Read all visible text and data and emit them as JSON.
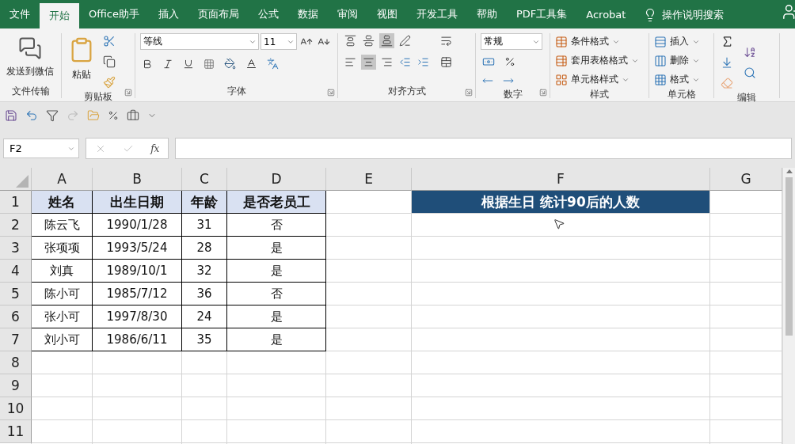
{
  "tabs": [
    {
      "label": "文件",
      "selected": false
    },
    {
      "label": "开始",
      "selected": true
    },
    {
      "label": "Office助手",
      "selected": false
    },
    {
      "label": "插入",
      "selected": false
    },
    {
      "label": "页面布局",
      "selected": false
    },
    {
      "label": "公式",
      "selected": false
    },
    {
      "label": "数据",
      "selected": false
    },
    {
      "label": "审阅",
      "selected": false
    },
    {
      "label": "视图",
      "selected": false
    },
    {
      "label": "开发工具",
      "selected": false
    },
    {
      "label": "帮助",
      "selected": false
    },
    {
      "label": "PDF工具集",
      "selected": false
    },
    {
      "label": "Acrobat",
      "selected": false
    }
  ],
  "search": {
    "label": "操作说明搜索"
  },
  "ribbon": {
    "groups": [
      {
        "kind": "share",
        "label": "文件传输",
        "buttons": [
          {
            "label": "发送到微信"
          }
        ]
      },
      {
        "kind": "clipboard",
        "label": "剪贴板",
        "buttons": [
          {
            "label": "粘贴"
          }
        ]
      },
      {
        "kind": "font",
        "label": "字体",
        "font": "等线",
        "size": "11"
      },
      {
        "kind": "alignment",
        "label": "对齐方式",
        "vertical_align": [
          {
            "selected": false
          },
          {
            "selected": false
          },
          {
            "selected": true
          }
        ],
        "horizontal_align": [
          {
            "selected": false
          },
          {
            "selected": true
          },
          {
            "selected": false
          }
        ]
      },
      {
        "kind": "number",
        "label": "数字",
        "format": "常规"
      },
      {
        "kind": "styles",
        "label": "样式",
        "buttons": [
          {
            "label": "条件格式"
          },
          {
            "label": "套用表格格式"
          },
          {
            "label": "单元格样式"
          }
        ]
      },
      {
        "kind": "cells",
        "label": "单元格",
        "buttons": [
          {
            "label": "插入"
          },
          {
            "label": "删除"
          },
          {
            "label": "格式"
          }
        ]
      },
      {
        "kind": "editing",
        "label": "编辑"
      }
    ]
  },
  "formula_bar": {
    "name_box": "F2",
    "fx": "fx"
  },
  "sheet": {
    "columns": [
      "A",
      "B",
      "C",
      "D",
      "E",
      "F",
      "G"
    ],
    "rows": [
      {
        "number": "1",
        "cells": [
          {
            "text": "姓名",
            "kind": "header"
          },
          {
            "text": "出生日期",
            "kind": "header"
          },
          {
            "text": "年龄",
            "kind": "header"
          },
          {
            "text": "是否老员工",
            "kind": "header"
          },
          {
            "text": ""
          },
          {
            "text": "根据生日 统计90后的人数",
            "kind": "title"
          }
        ]
      },
      {
        "number": "2",
        "cells": [
          {
            "text": "陈云飞",
            "kind": "data"
          },
          {
            "text": "1990/1/28",
            "kind": "data"
          },
          {
            "text": "31",
            "kind": "data"
          },
          {
            "text": "否",
            "kind": "data"
          }
        ]
      },
      {
        "number": "3",
        "cells": [
          {
            "text": "张项项",
            "kind": "data"
          },
          {
            "text": "1993/5/24",
            "kind": "data"
          },
          {
            "text": "28",
            "kind": "data"
          },
          {
            "text": "是",
            "kind": "data"
          }
        ]
      },
      {
        "number": "4",
        "cells": [
          {
            "text": "刘真",
            "kind": "data"
          },
          {
            "text": "1989/10/1",
            "kind": "data"
          },
          {
            "text": "32",
            "kind": "data"
          },
          {
            "text": "是",
            "kind": "data"
          }
        ]
      },
      {
        "number": "5",
        "cells": [
          {
            "text": "陈小可",
            "kind": "data"
          },
          {
            "text": "1985/7/12",
            "kind": "data"
          },
          {
            "text": "36",
            "kind": "data"
          },
          {
            "text": "否",
            "kind": "data"
          }
        ]
      },
      {
        "number": "6",
        "cells": [
          {
            "text": "张小可",
            "kind": "data"
          },
          {
            "text": "1997/8/30",
            "kind": "data"
          },
          {
            "text": "24",
            "kind": "data"
          },
          {
            "text": "是",
            "kind": "data"
          }
        ]
      },
      {
        "number": "7",
        "cells": [
          {
            "text": "刘小可",
            "kind": "data"
          },
          {
            "text": "1986/6/11",
            "kind": "data"
          },
          {
            "text": "35",
            "kind": "data"
          },
          {
            "text": "是",
            "kind": "data"
          }
        ]
      },
      {
        "number": "8",
        "cells": []
      },
      {
        "number": "9",
        "cells": []
      },
      {
        "number": "10",
        "cells": []
      },
      {
        "number": "11",
        "cells": []
      }
    ]
  }
}
